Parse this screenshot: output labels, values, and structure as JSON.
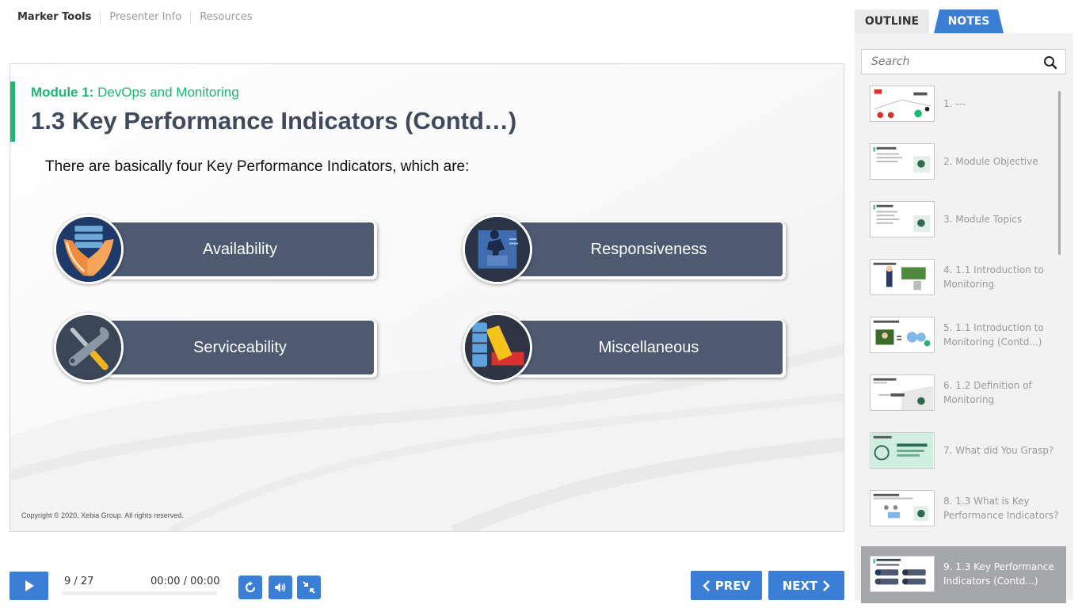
{
  "top_nav": [
    "Marker Tools",
    "Presenter Info",
    "Resources"
  ],
  "slide": {
    "module_prefix": "Module 1:",
    "module_name": "DevOps and Monitoring",
    "title": "1.3 Key Performance Indicators (Contd…)",
    "intro": "There are basically four Key Performance Indicators, which are:",
    "kpis": [
      "Availability",
      "Responsiveness",
      "Serviceability",
      "Miscellaneous"
    ],
    "copyright": "Copyright © 2020, Xebia Group. All rights reserved."
  },
  "player": {
    "slide_counter": "9 / 27",
    "time": "00:00 / 00:00",
    "progress_fraction": 0,
    "prev_label": "PREV",
    "next_label": "NEXT"
  },
  "panel": {
    "tabs": [
      "OUTLINE",
      "NOTES"
    ],
    "active_tab": "NOTES",
    "search_placeholder": "Search",
    "items": [
      "1. ---",
      "2. Module Objective",
      "3. Module Topics",
      "4. 1.1 Introduction to Monitoring",
      "5. 1.1 Introduction to Monitoring (Contd...)",
      "6. 1.2 Definition of Monitoring",
      "7. What did You Grasp?",
      "8. 1.3 What is Key Performance Indicators?",
      "9. 1.3 Key Performance Indicators (Contd...)"
    ],
    "active_item_index": 8
  },
  "colors": {
    "accent_green": "#1fb573",
    "button_blue": "#3a7fd5",
    "pill": "#4d5a72",
    "active_item": "#a5a6aa"
  }
}
